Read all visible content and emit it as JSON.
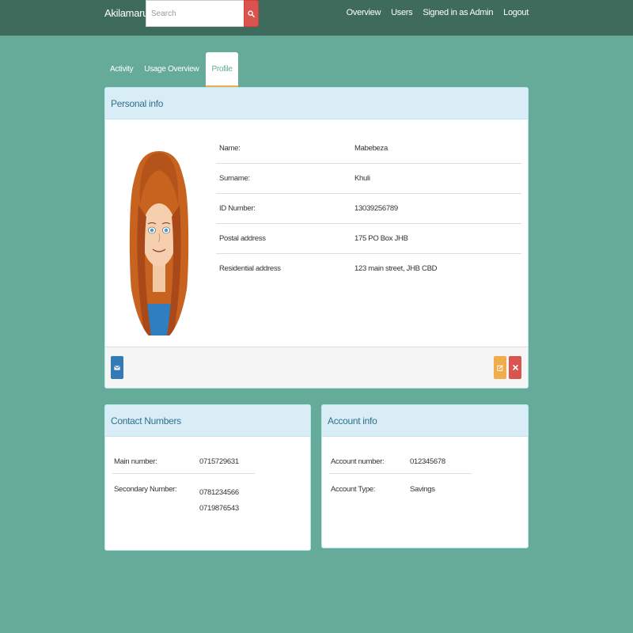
{
  "navbar": {
    "brand": "Akilamaru",
    "search": {
      "placeholder": "Search",
      "value": ""
    },
    "links": [
      {
        "label": "Overview"
      },
      {
        "label": "Users"
      },
      {
        "label": "Signed in as Admin"
      },
      {
        "label": "Logout"
      }
    ]
  },
  "tabs": [
    {
      "label": "Activity",
      "active": false
    },
    {
      "label": "Usage Overview",
      "active": false
    },
    {
      "label": "Profile",
      "active": true
    }
  ],
  "personal_info": {
    "heading": "Personal info",
    "rows": [
      {
        "label": "Name:",
        "value": "Mabebeza"
      },
      {
        "label": "Surname:",
        "value": "Khuli"
      },
      {
        "label": "ID Number:",
        "value": "13039256789"
      },
      {
        "label": "Postal address",
        "value": "175 PO Box JHB"
      },
      {
        "label": "Residential address",
        "value": "123 main street, JHB CBD"
      }
    ],
    "buttons": {
      "message_icon": "envelope-icon",
      "edit_icon": "edit-icon",
      "delete_icon": "remove-icon"
    }
  },
  "contact_numbers": {
    "heading": "Contact Numbers",
    "rows": [
      {
        "label": "Main number:",
        "values": [
          "0715729631"
        ]
      },
      {
        "label": "Secondary Number:",
        "values": [
          "0781234566",
          "0719876543"
        ]
      }
    ]
  },
  "account_info": {
    "heading": "Account info",
    "rows": [
      {
        "label": "Account number:",
        "value": "012345678"
      },
      {
        "label": "Account Type:",
        "value": "Savings"
      }
    ]
  },
  "colors": {
    "page_background": "#66aa9a",
    "navbar": "#3e6b5c",
    "panel_heading": "#d9edf7",
    "primary": "#337ab7",
    "warning": "#f0ad4e",
    "danger": "#d9534f"
  }
}
